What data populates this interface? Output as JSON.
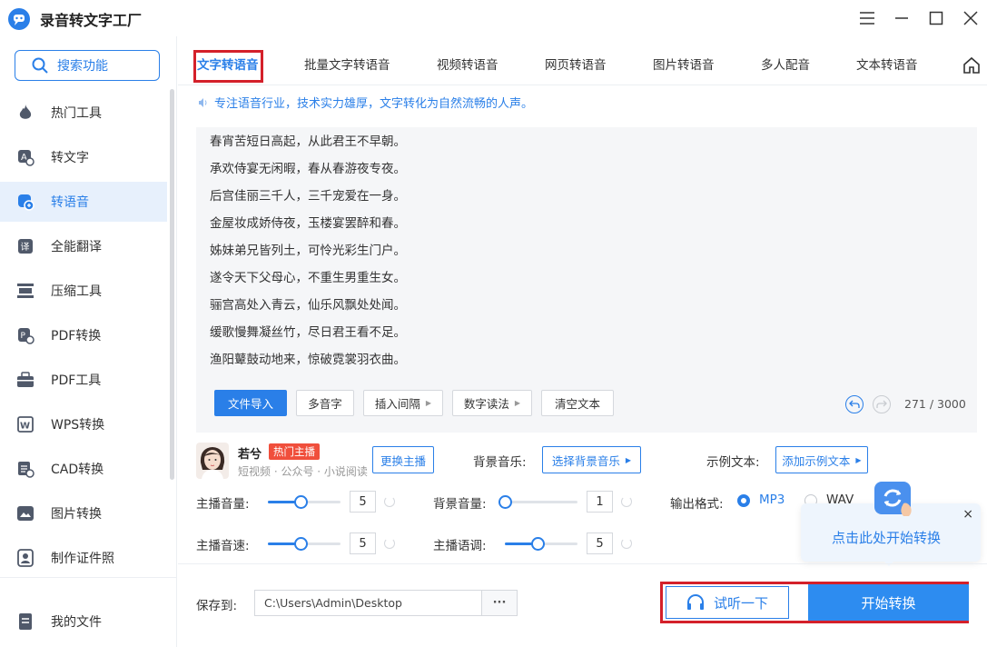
{
  "app": {
    "title": "录音转文字工厂"
  },
  "sidebar": {
    "search_label": "搜索功能",
    "items": [
      {
        "label": "热门工具",
        "icon": "flame-icon"
      },
      {
        "label": "转文字",
        "icon": "text-convert-icon"
      },
      {
        "label": "转语音",
        "icon": "voice-convert-icon",
        "active": true
      },
      {
        "label": "全能翻译",
        "icon": "translate-icon"
      },
      {
        "label": "压缩工具",
        "icon": "compress-icon"
      },
      {
        "label": "PDF转换",
        "icon": "pdf-convert-icon"
      },
      {
        "label": "PDF工具",
        "icon": "toolbox-icon"
      },
      {
        "label": "WPS转换",
        "icon": "wps-icon"
      },
      {
        "label": "CAD转换",
        "icon": "cad-icon"
      },
      {
        "label": "图片转换",
        "icon": "image-icon"
      },
      {
        "label": "制作证件照",
        "icon": "id-photo-icon"
      }
    ],
    "my_files": "我的文件"
  },
  "tabs": [
    {
      "label": "文字转语音",
      "active": true
    },
    {
      "label": "批量文字转语音"
    },
    {
      "label": "视频转语音"
    },
    {
      "label": "网页转语音"
    },
    {
      "label": "图片转语音"
    },
    {
      "label": "多人配音"
    },
    {
      "label": "文本转语音"
    }
  ],
  "slogan": "专注语音行业，技术实力雄厚，文字转化为自然流畅的人声。",
  "editor": {
    "lines": [
      "春宵苦短日高起，从此君王不早朝。",
      "承欢侍宴无闲暇，春从春游夜专夜。",
      "后宫佳丽三千人，三千宠爱在一身。",
      "金屋妆成娇侍夜，玉楼宴罢醉和春。",
      "姊妹弟兄皆列土，可怜光彩生门户。",
      "遂令天下父母心，不重生男重生女。",
      "骊宫高处入青云，仙乐风飘处处闻。",
      "缓歌慢舞凝丝竹，尽日君王看不足。",
      "渔阳鼙鼓动地来，惊破霓裳羽衣曲。"
    ],
    "import_btn": "文件导入",
    "polyphone_btn": "多音字",
    "insert_pause_btn": "插入间隔",
    "number_read_btn": "数字读法",
    "clear_btn": "清空文本",
    "count": "271 / 3000"
  },
  "anchor": {
    "name": "若兮",
    "badge": "热门主播",
    "tags": "短视频 · 公众号 · 小说阅读",
    "change_btn": "更换主播",
    "bg_music_label": "背景音乐:",
    "bg_music_btn": "选择背景音乐",
    "sample_label": "示例文本:",
    "sample_btn": "添加示例文本"
  },
  "controls": {
    "anchor_volume_label": "主播音量:",
    "anchor_volume": "5",
    "anchor_volume_ratio": 0.45,
    "bg_volume_label": "背景音量:",
    "bg_volume": "1",
    "bg_volume_ratio": 0.0,
    "speed_label": "主播音速:",
    "speed": "5",
    "speed_ratio": 0.45,
    "pitch_label": "主播语调:",
    "pitch": "5",
    "pitch_ratio": 0.45,
    "format_label": "输出格式:",
    "format_mp3": "MP3",
    "format_wav": "WAV"
  },
  "popup": {
    "text": "点击此处开始转换",
    "close": "×"
  },
  "bottom": {
    "save_label": "保存到:",
    "save_path": "C:\\Users\\Admin\\Desktop",
    "more": "···",
    "listen_btn": "试听一下",
    "start_btn": "开始转换"
  },
  "colors": {
    "accent": "#2a7fe8",
    "highlight_box": "#d4202a",
    "badge": "#f04f3c"
  }
}
